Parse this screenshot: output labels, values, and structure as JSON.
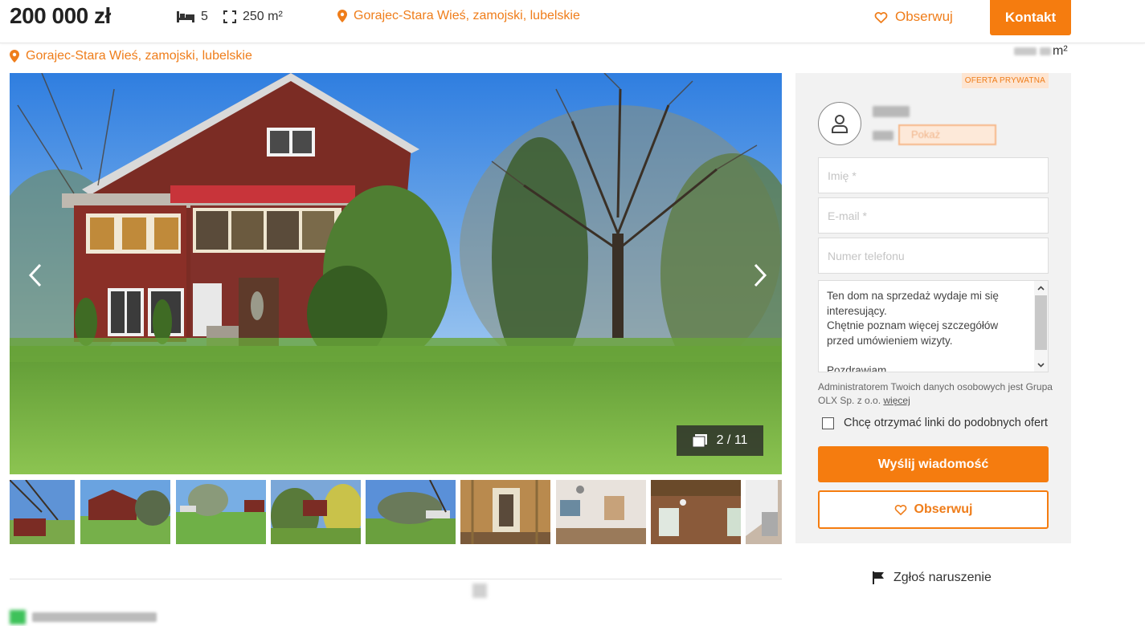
{
  "header": {
    "price": "200 000 zł",
    "rooms": "5",
    "area": "250 m²",
    "location": "Gorajec-Stara Wieś, zamojski, lubelskie",
    "watch_label": "Obserwuj",
    "contact_label": "Kontakt"
  },
  "subheader": {
    "location": "Gorajec-Stara Wieś, zamojski, lubelskie",
    "area_unit": "m²"
  },
  "gallery": {
    "counter": "2 / 11",
    "thumbnail_count": 9
  },
  "contact_panel": {
    "badge": "OFERTA PRYWATNA",
    "show_phone_label": "Pokaż",
    "name_placeholder": "Imię *",
    "email_placeholder": "E-mail *",
    "phone_placeholder": "Numer telefonu",
    "message": "Ten dom na sprzedaż wydaje mi się interesujący.\nChętnie poznam więcej szczegółów przed umówieniem wizyty.\n\nPozdrawiam",
    "admin_note": "Administratorem Twoich danych osobowych jest Grupa OLX Sp. z o.o.",
    "admin_more": "więcej",
    "similar_offers_label": "Chcę otrzymać linki do podobnych ofert",
    "send_label": "Wyślij wiadomość",
    "watch_label": "Obserwuj"
  },
  "report_label": "Zgłoś naruszenie",
  "colors": {
    "accent": "#f57c0f",
    "accent_text": "#ef7d1a",
    "panel_bg": "#f2f2f2"
  }
}
